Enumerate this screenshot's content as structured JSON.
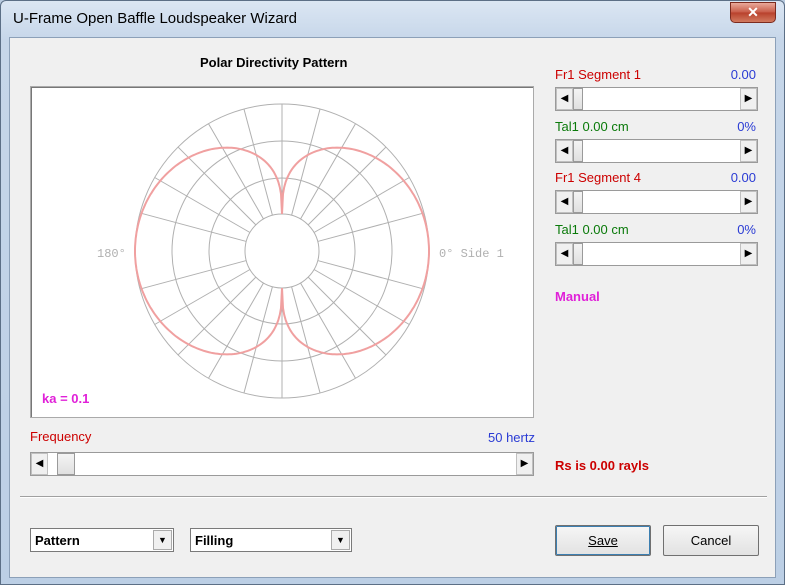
{
  "window": {
    "title": "U-Frame Open Baffle Loudspeaker Wizard",
    "close_glyph": "✕"
  },
  "polar": {
    "title": "Polar Directivity Pattern",
    "label_left": "180°",
    "label_right": "0° Side 1",
    "ka_label": "ka = 0.1",
    "pattern_color": "#f0a0a0",
    "grid_color": "#b0b0b0"
  },
  "frequency": {
    "label": "Frequency",
    "value": "50 hertz",
    "slider_fraction": 0.02
  },
  "controls": [
    {
      "label": "Fr1  Segment 1",
      "value": "0.00",
      "label_color": "red",
      "slider_fraction": 0.0
    },
    {
      "label": "Tal1  0.00 cm",
      "value": "0%",
      "label_color": "green",
      "slider_fraction": 0.0
    },
    {
      "label": "Fr1  Segment 4",
      "value": "0.00",
      "label_color": "red",
      "slider_fraction": 0.0
    },
    {
      "label": "Tal1  0.00 cm",
      "value": "0%",
      "label_color": "green",
      "slider_fraction": 0.0
    }
  ],
  "mode": "Manual",
  "rs_text": "Rs is 0.00 rayls",
  "combo_pattern": "Pattern",
  "combo_filling": "Filling",
  "buttons": {
    "save": "Save",
    "cancel": "Cancel"
  },
  "arrows": {
    "left": "◀",
    "right": "▶",
    "down": "▼"
  }
}
